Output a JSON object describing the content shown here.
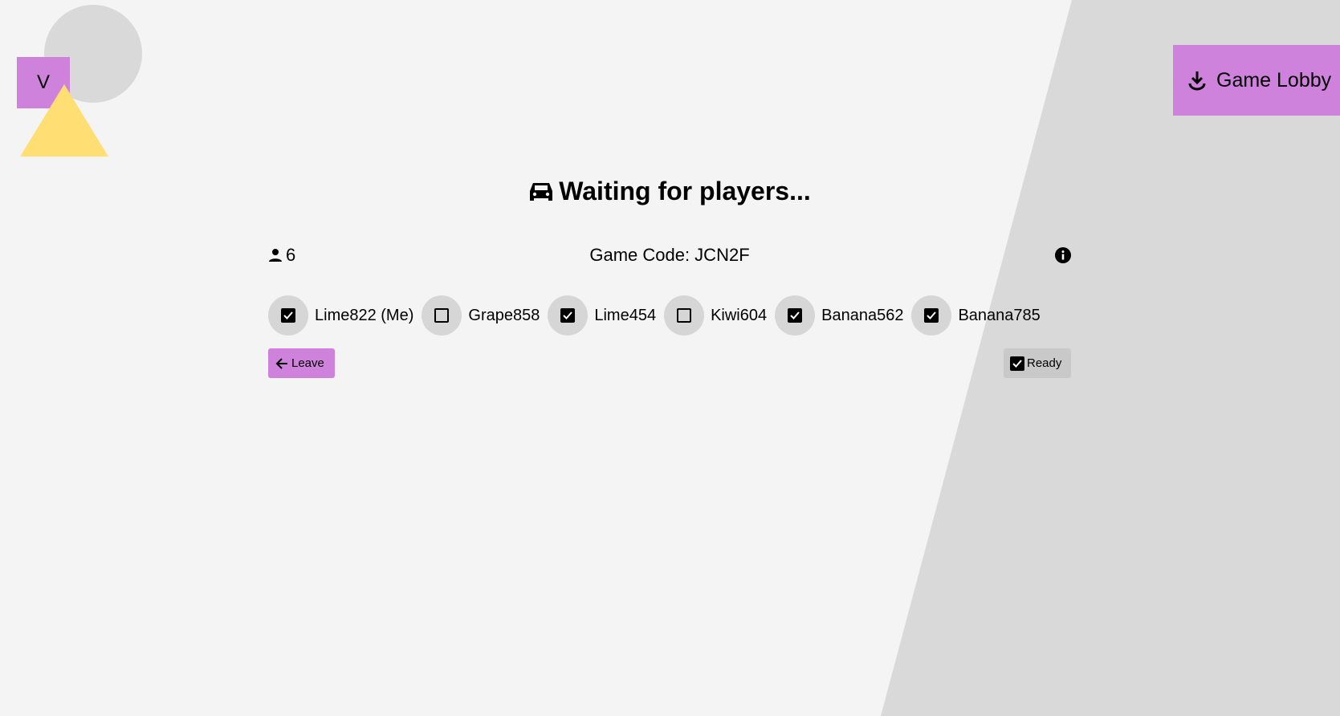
{
  "avatar": {
    "letter": "V"
  },
  "header": {
    "lobby_label": "Game Lobby",
    "lobby_icon": "download-icon"
  },
  "title": "Waiting for players...",
  "player_count": "6",
  "game_code": "Game Code: JCN2F",
  "players": [
    {
      "name": "Lime822 (Me)",
      "ready": true
    },
    {
      "name": "Grape858",
      "ready": false
    },
    {
      "name": "Lime454",
      "ready": true
    },
    {
      "name": "Kiwi604",
      "ready": false
    },
    {
      "name": "Banana562",
      "ready": true
    },
    {
      "name": "Banana785",
      "ready": true
    }
  ],
  "buttons": {
    "leave": "Leave",
    "ready": "Ready"
  },
  "colors": {
    "accent": "#cf82dc",
    "yellow": "#ffde74",
    "grey": "#d9d9d9",
    "background": "#f4f4f4"
  }
}
